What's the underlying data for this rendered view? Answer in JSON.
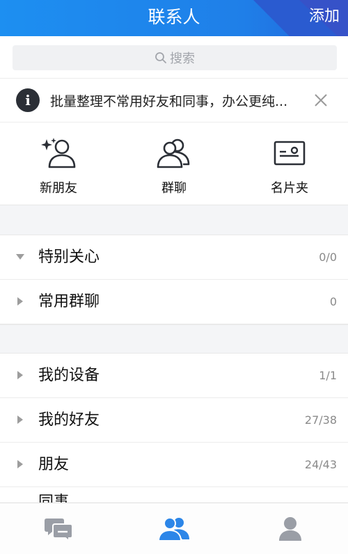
{
  "header": {
    "title": "联系人",
    "add_label": "添加"
  },
  "search": {
    "placeholder": "搜索"
  },
  "notice": {
    "text": "批量整理不常用好友和同事，办公更纯..."
  },
  "quick_actions": [
    {
      "label": "新朋友",
      "icon": "add-friend-icon"
    },
    {
      "label": "群聊",
      "icon": "group-chat-icon"
    },
    {
      "label": "名片夹",
      "icon": "card-holder-icon"
    }
  ],
  "groups": [
    {
      "name": "特别关心",
      "count": "0/0",
      "expanded": true
    },
    {
      "name": "常用群聊",
      "count": "0",
      "expanded": false
    },
    {
      "name": "我的设备",
      "count": "1/1",
      "expanded": false
    },
    {
      "name": "我的好友",
      "count": "27/38",
      "expanded": false
    },
    {
      "name": "朋友",
      "count": "24/43",
      "expanded": false
    }
  ],
  "partial_group": {
    "name": "同事"
  },
  "tabbar": {
    "tabs": [
      {
        "icon": "messages-icon",
        "active": false
      },
      {
        "icon": "contacts-icon",
        "active": true
      },
      {
        "icon": "profile-icon",
        "active": false
      }
    ]
  },
  "colors": {
    "accent": "#1e8ae9",
    "header_blue": "#1d8ff1",
    "tab_inactive": "#9a9ea6"
  }
}
